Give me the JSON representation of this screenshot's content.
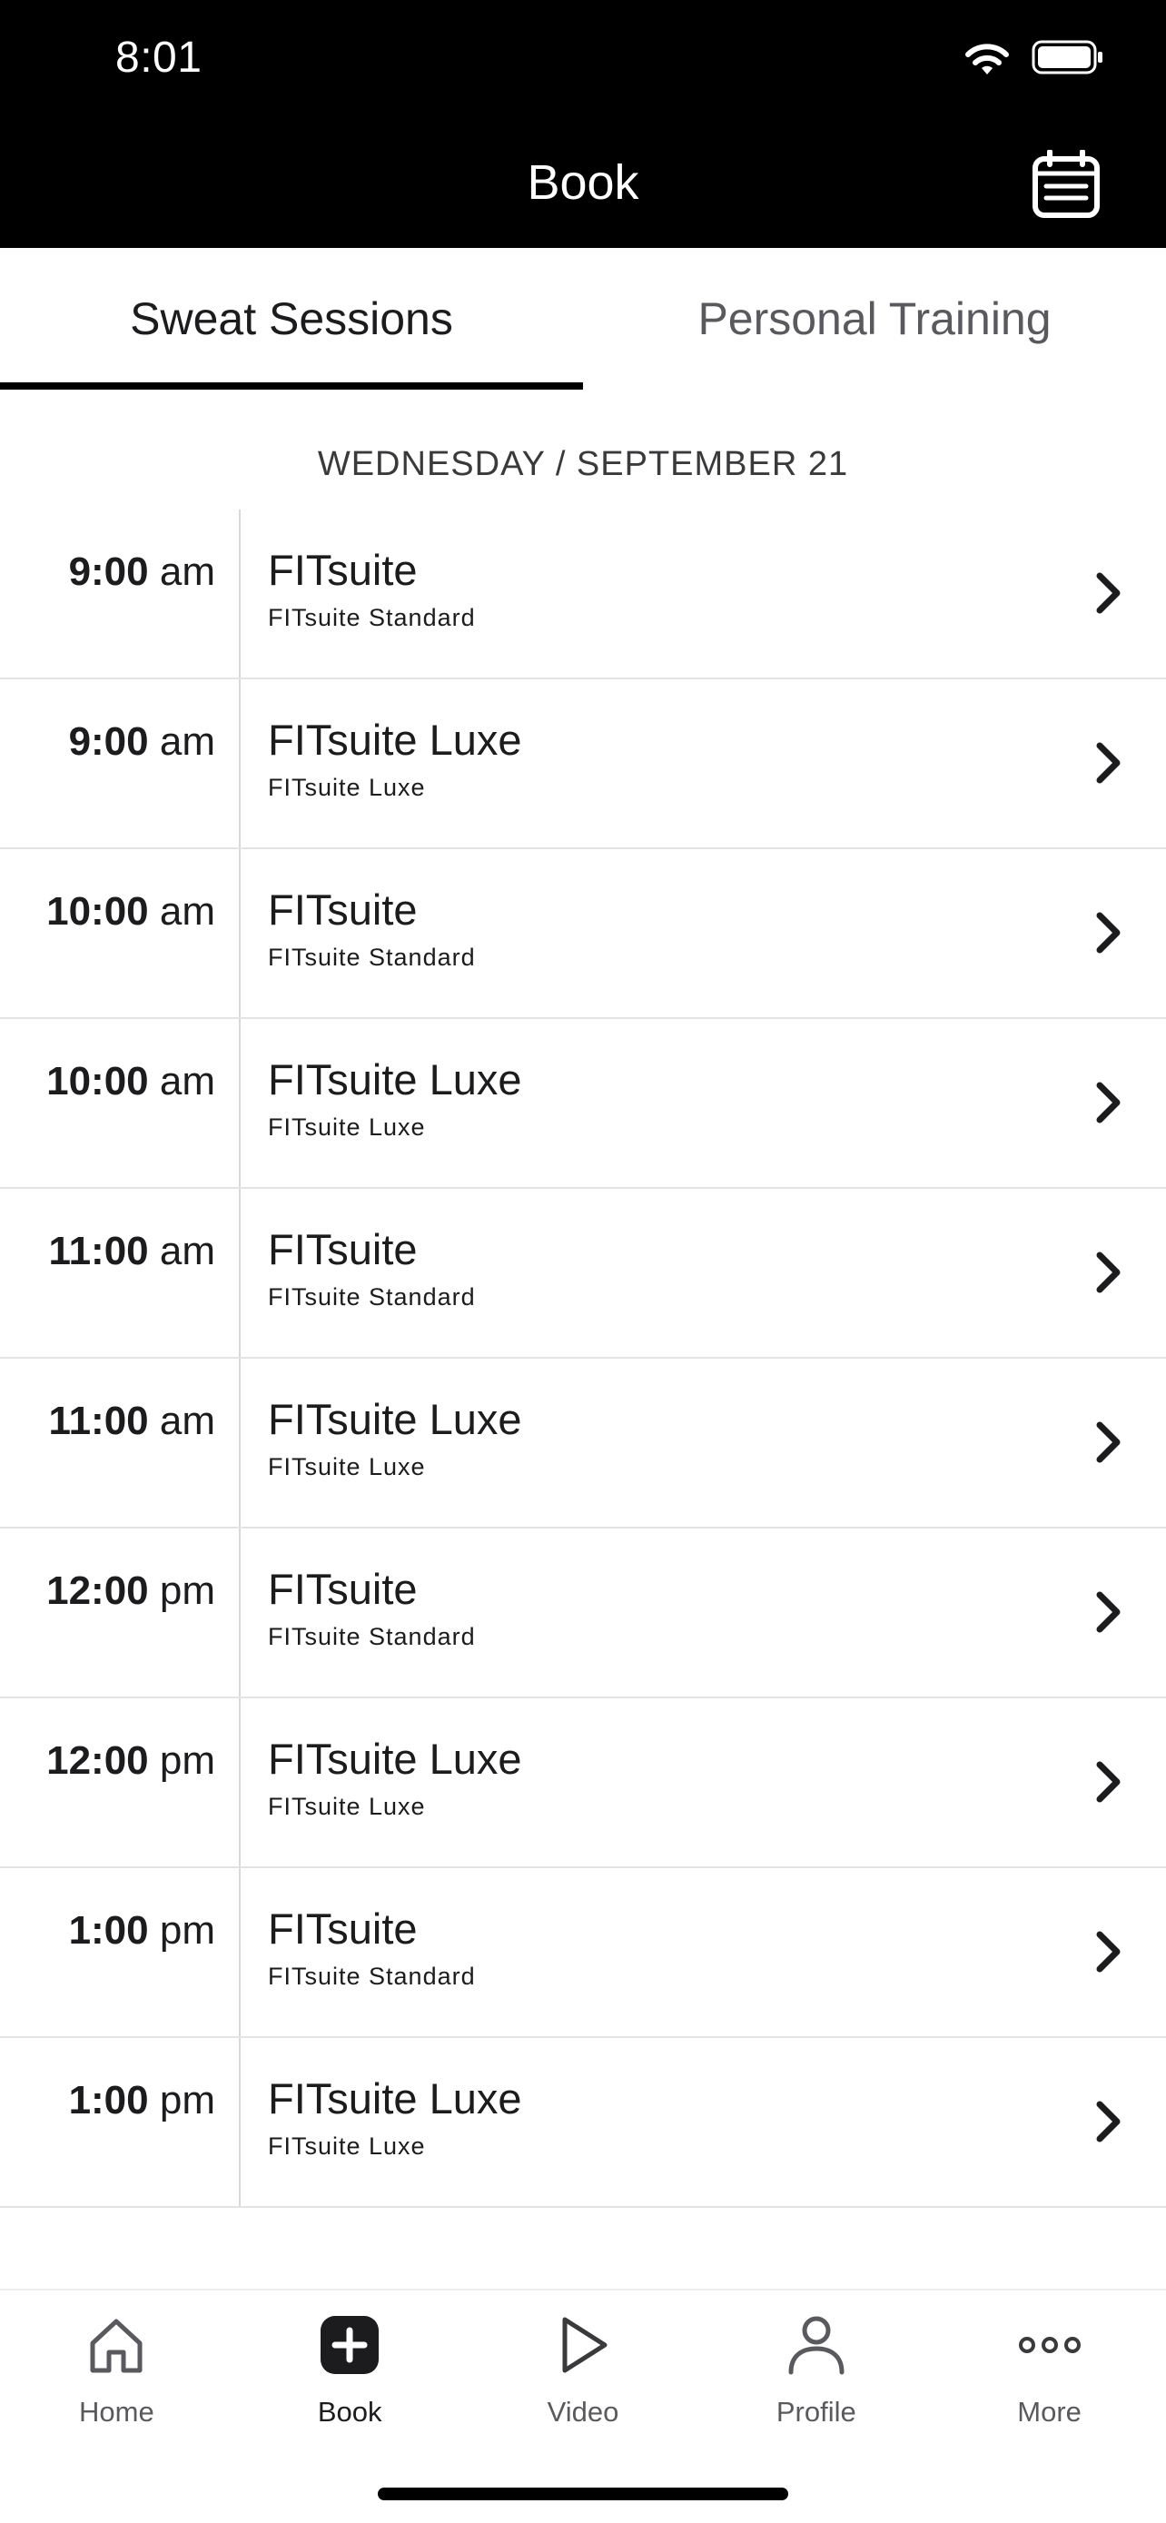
{
  "status_bar": {
    "time": "8:01"
  },
  "header": {
    "title": "Book"
  },
  "tabs": [
    {
      "label": "Sweat Sessions",
      "active": true
    },
    {
      "label": "Personal Training",
      "active": false
    }
  ],
  "date_label": "WEDNESDAY / SEPTEMBER 21",
  "sessions": [
    {
      "time": "9:00",
      "period": "am",
      "name": "FITsuite",
      "type": "FITsuite Standard"
    },
    {
      "time": "9:00",
      "period": "am",
      "name": "FITsuite Luxe",
      "type": "FITsuite Luxe"
    },
    {
      "time": "10:00",
      "period": "am",
      "name": "FITsuite",
      "type": "FITsuite Standard"
    },
    {
      "time": "10:00",
      "period": "am",
      "name": "FITsuite Luxe",
      "type": "FITsuite Luxe"
    },
    {
      "time": "11:00",
      "period": "am",
      "name": "FITsuite",
      "type": "FITsuite Standard"
    },
    {
      "time": "11:00",
      "period": "am",
      "name": "FITsuite Luxe",
      "type": "FITsuite Luxe"
    },
    {
      "time": "12:00",
      "period": "pm",
      "name": "FITsuite",
      "type": "FITsuite Standard"
    },
    {
      "time": "12:00",
      "period": "pm",
      "name": "FITsuite Luxe",
      "type": "FITsuite Luxe"
    },
    {
      "time": "1:00",
      "period": "pm",
      "name": "FITsuite",
      "type": "FITsuite Standard"
    },
    {
      "time": "1:00",
      "period": "pm",
      "name": "FITsuite Luxe",
      "type": "FITsuite Luxe"
    }
  ],
  "tabbar": {
    "items": [
      {
        "label": "Home",
        "icon": "home-icon",
        "active": false
      },
      {
        "label": "Book",
        "icon": "plus-square-icon",
        "active": true
      },
      {
        "label": "Video",
        "icon": "play-icon",
        "active": false
      },
      {
        "label": "Profile",
        "icon": "person-icon",
        "active": false
      },
      {
        "label": "More",
        "icon": "more-dots-icon",
        "active": false
      }
    ]
  },
  "colors": {
    "header_bg": "#000000",
    "text": "#1c1c1e",
    "muted": "#5a5a5e",
    "divider": "#e3e3e5"
  }
}
